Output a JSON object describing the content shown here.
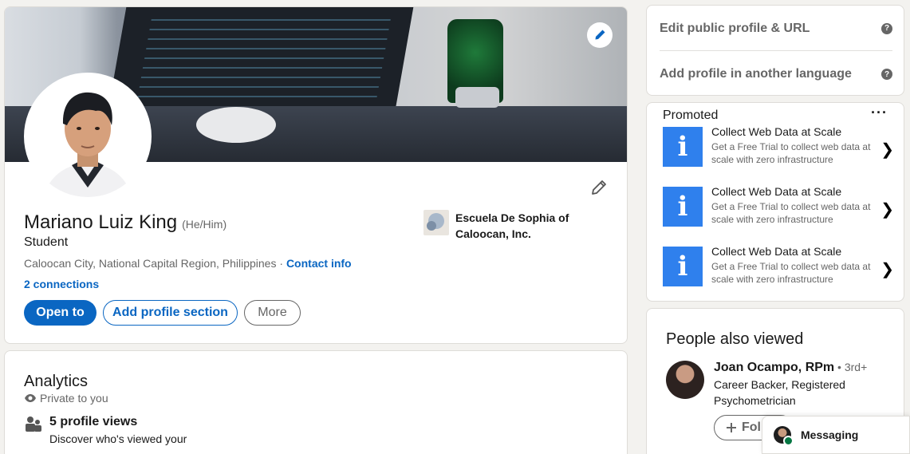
{
  "profile": {
    "name": "Mariano Luiz King",
    "pronouns": "(He/Him)",
    "headline": "Student",
    "location": "Caloocan City, National Capital Region, Philippines",
    "separator": " · ",
    "contact_info": "Contact info",
    "connections": "2 connections",
    "buttons": {
      "open_to": "Open to",
      "add_section": "Add profile section",
      "more": "More"
    },
    "education": "Escuela De Sophia of Caloocan, Inc."
  },
  "analytics": {
    "title": "Analytics",
    "private": "Private to you",
    "item_title": "5 profile views",
    "item_desc": "Discover who's viewed your"
  },
  "settings": {
    "edit_public": "Edit public profile & URL",
    "add_language": "Add profile in another language",
    "help_glyph": "?"
  },
  "promoted": {
    "label": "Promoted",
    "menu": "···",
    "ads": [
      {
        "title": "Collect Web Data at Scale",
        "desc": "Get a Free Trial to collect web data at scale with zero infrastructure"
      },
      {
        "title": "Collect Web Data at Scale",
        "desc": "Get a Free Trial to collect web data at scale with zero infrastructure"
      },
      {
        "title": "Collect Web Data at Scale",
        "desc": "Get a Free Trial to collect web data at scale with zero infrastructure"
      }
    ],
    "chevron": "❯"
  },
  "people_also_viewed": {
    "title": "People also viewed",
    "person": {
      "name": "Joan Ocampo, RPm",
      "degree": " • 3rd+",
      "headline": "Career Backer, Registered Psychometrician",
      "follow": "Foll"
    }
  },
  "messaging": {
    "label": "Messaging"
  },
  "colors": {
    "brand_blue": "#0a66c2",
    "ad_blue": "#2f80ed",
    "online_green": "#057642"
  },
  "icons": {
    "edit_banner": "pencil-icon",
    "edit_intro": "pencil-icon",
    "analytics_private": "eye-icon",
    "analytics_item": "people-icon",
    "help": "help-circle-icon",
    "ad_logo": "info-icon",
    "follow": "plus-icon"
  }
}
